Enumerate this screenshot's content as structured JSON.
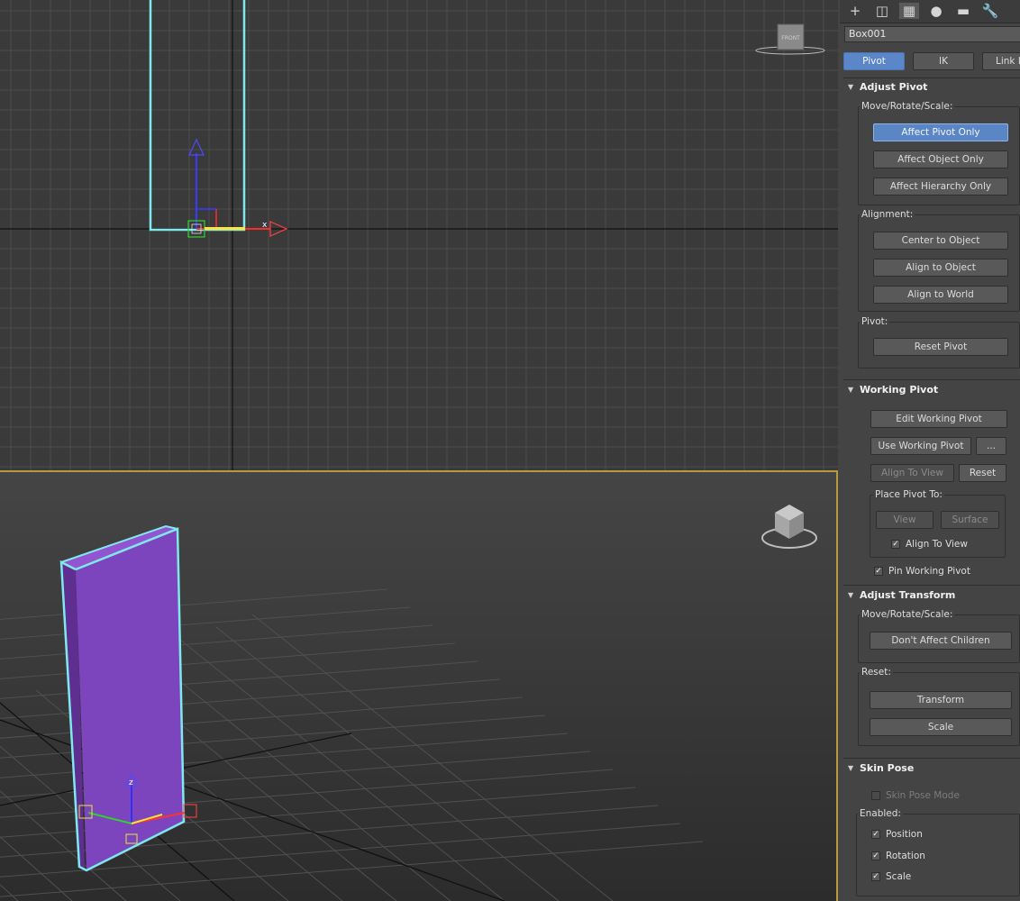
{
  "front_viewport": {
    "viewcube_label": "FRONT",
    "axis_label": "x"
  },
  "perspective_viewport": {
    "axis_label": "z"
  },
  "command_panel": {
    "tabs": [
      {
        "name": "create",
        "icon": "+"
      },
      {
        "name": "modify",
        "icon": "◫"
      },
      {
        "name": "hierarchy",
        "icon": "▦"
      },
      {
        "name": "motion",
        "icon": "●"
      },
      {
        "name": "display",
        "icon": "▬"
      },
      {
        "name": "utilities",
        "icon": "🔧"
      }
    ],
    "object_name": "Box001",
    "subtabs": [
      "Pivot",
      "IK",
      "Link Info"
    ],
    "adjust_pivot": {
      "title": "Adjust Pivot",
      "move_rotate_scale_label": "Move/Rotate/Scale:",
      "affect_pivot_only": "Affect Pivot Only",
      "affect_object_only": "Affect Object Only",
      "affect_hierarchy_only": "Affect Hierarchy Only",
      "alignment_label": "Alignment:",
      "center_to_object": "Center to Object",
      "align_to_object": "Align to Object",
      "align_to_world": "Align to World",
      "pivot_label": "Pivot:",
      "reset_pivot": "Reset Pivot"
    },
    "working_pivot": {
      "title": "Working Pivot",
      "edit_working_pivot": "Edit Working Pivot",
      "use_working_pivot": "Use Working Pivot",
      "more": "...",
      "align_to_view": "Align To View",
      "reset": "Reset",
      "place_pivot_to_label": "Place Pivot To:",
      "view": "View",
      "surface": "Surface",
      "align_to_view_check": "Align To View",
      "pin_working_pivot": "Pin Working Pivot"
    },
    "adjust_transform": {
      "title": "Adjust Transform",
      "move_rotate_scale_label": "Move/Rotate/Scale:",
      "dont_affect_children": "Don't Affect Children",
      "reset_label": "Reset:",
      "transform": "Transform",
      "scale": "Scale"
    },
    "skin_pose": {
      "title": "Skin Pose",
      "skin_pose_mode": "Skin Pose Mode",
      "enabled_label": "Enabled:",
      "position": "Position",
      "rotation": "Rotation",
      "scale": "Scale"
    },
    "colors": {
      "active_button": "#5b86c6",
      "selection_outline": "#7fe8ee",
      "object_fill": "#8a4bc4"
    }
  }
}
